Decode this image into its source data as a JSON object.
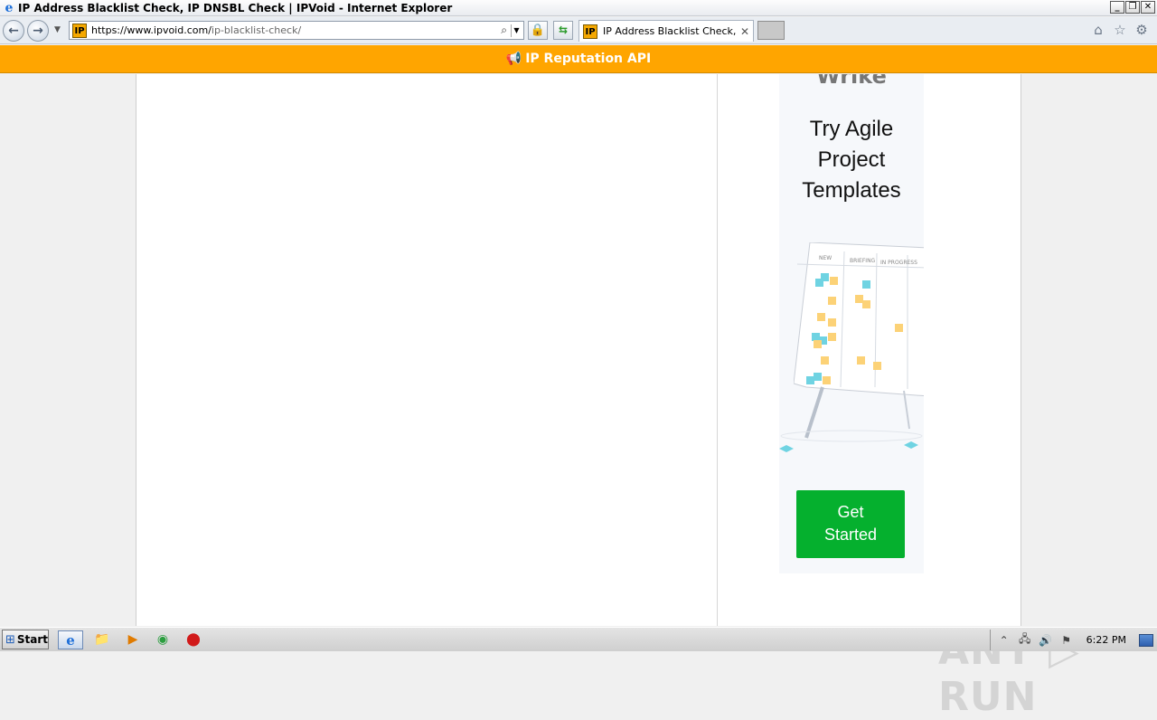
{
  "window": {
    "title": "IP Address Blacklist Check, IP DNSBL Check | IPVoid - Internet Explorer",
    "buttons": {
      "minimize": "_",
      "restore": "❐",
      "close": "✕"
    }
  },
  "navbar": {
    "back_icon": "←",
    "forward_icon": "→",
    "dropdown_icon": "▼",
    "site_icon_text": "IP",
    "url_main": "https://www.ipvoid.com/",
    "url_rest": "ip-blacklist-check/",
    "search_icon": "⌕",
    "addr_dropdown_icon": "▼",
    "lock_icon": "🔒",
    "refresh_icon": "⇆",
    "tab_title": "IP Address Blacklist Check, I...",
    "tab_close": "✕",
    "home_icon": "⌂",
    "favorites_icon": "☆",
    "tools_icon": "⚙"
  },
  "banner": {
    "icon": "📢",
    "text": "IP Reputation API",
    "color": "#ffa500"
  },
  "ad": {
    "logo_text": "Wrike",
    "headline_lines": [
      "Try Agile",
      "Project",
      "Templates"
    ],
    "board_columns": [
      "NEW",
      "BRIEFING",
      "IN PROGRESS"
    ],
    "cta_lines": [
      "Get",
      "Started"
    ],
    "cta_color": "#05b02e"
  },
  "watermark": {
    "text": "ANY ▷ RUN"
  },
  "taskbar": {
    "start_label": "Start",
    "start_icon": "⊞",
    "items": [
      {
        "name": "ie",
        "icon": "e"
      },
      {
        "name": "explorer",
        "icon": "📁"
      },
      {
        "name": "media",
        "icon": "▶"
      },
      {
        "name": "chrome",
        "icon": "◉"
      },
      {
        "name": "opera",
        "icon": "⬤"
      }
    ],
    "tray_icons": [
      "⌃",
      "🖧",
      "🔊",
      "⚑"
    ],
    "clock": "6:22 PM"
  }
}
